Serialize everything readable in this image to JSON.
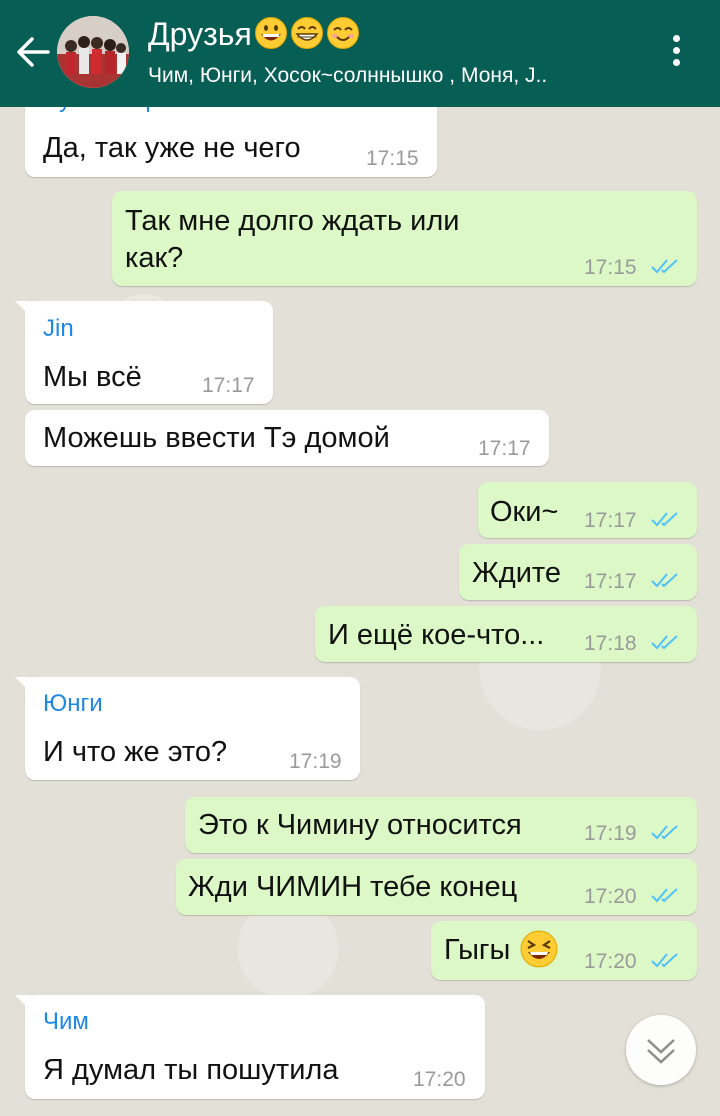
{
  "header": {
    "title": "Друзья",
    "subtitle": "Чим, Юнги, Хосок~солннышко , Моня, J..",
    "title_emoji": [
      "grinning-face",
      "beaming-face",
      "smiling-face"
    ]
  },
  "colors": {
    "header": "#075e54",
    "incoming": "#ffffff",
    "outgoing": "#dcf8c6",
    "sender_name": "#1e88e5",
    "read_ticks": "#4fc3f7"
  },
  "messages": [
    {
      "id": "m0",
      "dir": "in",
      "sender": "Лунный кролик",
      "text": "Да, так уже не чего",
      "time": "17:15"
    },
    {
      "id": "m1",
      "dir": "out",
      "text": "Так мне долго ждать или как?",
      "time": "17:15"
    },
    {
      "id": "m2",
      "dir": "in",
      "sender": "Jin",
      "text": "Мы всё",
      "time": "17:17"
    },
    {
      "id": "m3",
      "dir": "in",
      "text": "Можешь ввести Тэ домой",
      "time": "17:17"
    },
    {
      "id": "m4",
      "dir": "out",
      "text": "Оки~",
      "time": "17:17"
    },
    {
      "id": "m5",
      "dir": "out",
      "text": "Ждите",
      "time": "17:17"
    },
    {
      "id": "m6",
      "dir": "out",
      "text": "И ещё кое-что...",
      "time": "17:18"
    },
    {
      "id": "m7",
      "dir": "in",
      "sender": "Юнги",
      "text": "И что же это?",
      "time": "17:19"
    },
    {
      "id": "m8",
      "dir": "out",
      "text": "Это к Чимину относится",
      "time": "17:19"
    },
    {
      "id": "m9",
      "dir": "out",
      "text": "Жди ЧИМИН  тебе конец",
      "time": "17:20"
    },
    {
      "id": "m10",
      "dir": "out",
      "text": "Гыгы",
      "time": "17:20",
      "emoji": "laughing-face"
    },
    {
      "id": "m11",
      "dir": "in",
      "sender": "Чим",
      "text": "Я думал ты пошутила",
      "time": "17:20"
    }
  ]
}
